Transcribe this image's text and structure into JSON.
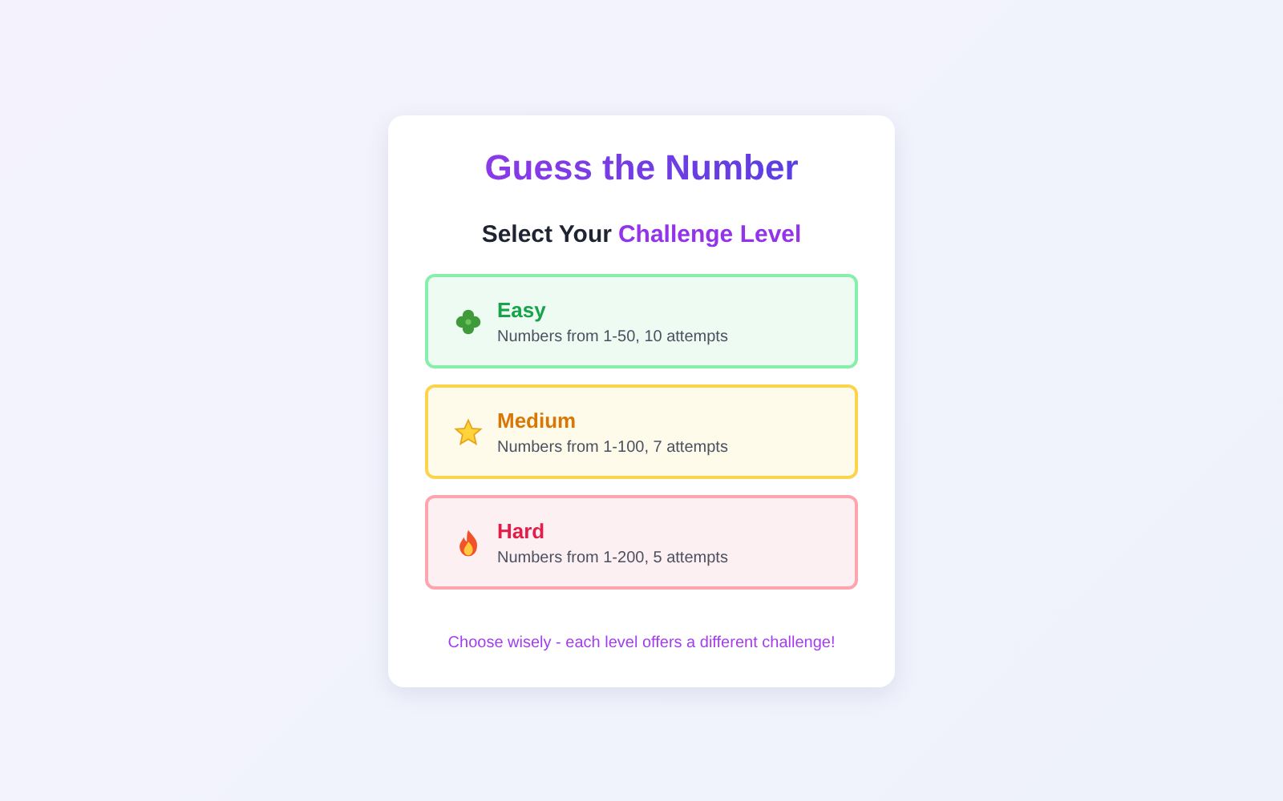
{
  "title": "Guess the Number",
  "subtitle": {
    "text": "Select Your",
    "highlight": "Challenge Level"
  },
  "levels": [
    {
      "kind": "easy",
      "name": "Easy",
      "description": "Numbers from 1-50, 10 attempts"
    },
    {
      "kind": "medium",
      "name": "Medium",
      "description": "Numbers from 1-100, 7 attempts"
    },
    {
      "kind": "hard",
      "name": "Hard",
      "description": "Numbers from 1-200, 5 attempts"
    }
  ],
  "footer": "Choose wisely - each level offers a different challenge!"
}
